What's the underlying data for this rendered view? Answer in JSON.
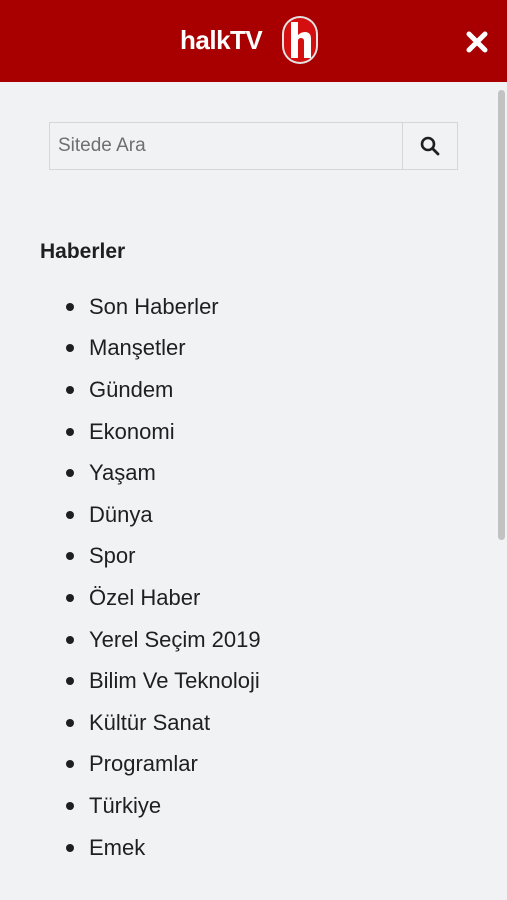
{
  "header": {
    "logo_text": "halkTV",
    "logo_icon": "halktv-h-logo-icon",
    "close_icon": "close-icon",
    "brand_color": "#a80000"
  },
  "search": {
    "placeholder": "Sitede Ara",
    "value": "",
    "button_icon": "search-icon"
  },
  "menu": {
    "title": "Haberler",
    "items": [
      "Son Haberler",
      "Manşetler",
      "Gündem",
      "Ekonomi",
      "Yaşam",
      "Dünya",
      "Spor",
      "Özel Haber",
      "Yerel Seçim 2019",
      "Bilim Ve Teknoloji",
      "Kültür Sanat",
      "Programlar",
      "Türkiye",
      "Emek"
    ]
  }
}
